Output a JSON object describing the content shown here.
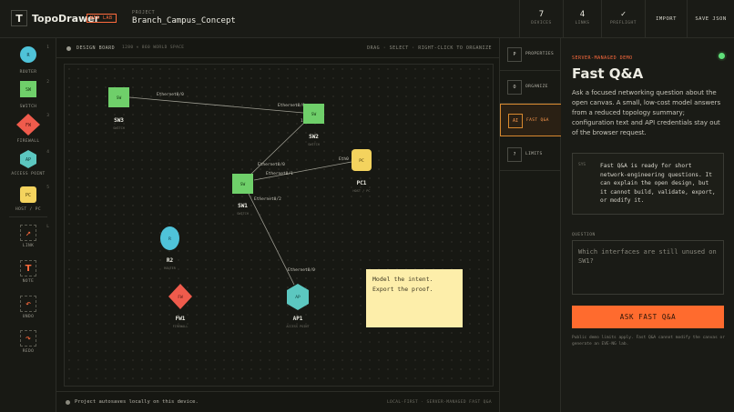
{
  "header": {
    "logo_letter": "T",
    "app_name": "TopoDrawer",
    "badge": "WEB LAB",
    "project_label": "PROJECT",
    "project_name": "Branch_Campus_Concept",
    "stats": [
      {
        "value": "7",
        "label": "DEVICES"
      },
      {
        "value": "4",
        "label": "LINKS"
      },
      {
        "value": "✓",
        "label": "PREFLIGHT"
      }
    ],
    "import_label": "IMPORT",
    "save_label": "SAVE JSON"
  },
  "toolbar": {
    "devices": [
      {
        "label": "ROUTER",
        "num": "1",
        "glyph": "R",
        "color": "#4fc3d9"
      },
      {
        "label": "SWITCH",
        "num": "2",
        "glyph": "SW",
        "color": "#6fcf6a"
      },
      {
        "label": "FIREWALL",
        "num": "3",
        "glyph": "FW",
        "color": "#ef5b4c"
      },
      {
        "label": "ACCESS POINT",
        "num": "4",
        "glyph": "AP",
        "color": "#5cc7c0"
      },
      {
        "label": "HOST / PC",
        "num": "5",
        "glyph": "PC",
        "color": "#f4d35e"
      }
    ],
    "tools": [
      {
        "label": "LINK",
        "num": "L",
        "glyph": "↗"
      },
      {
        "label": "NOTE",
        "num": "",
        "glyph": "T"
      },
      {
        "label": "UNDO",
        "num": "",
        "glyph": "↶"
      },
      {
        "label": "REDO",
        "num": "",
        "glyph": "↷"
      }
    ]
  },
  "canvas": {
    "title": "DESIGN BOARD",
    "subtitle": "1280 × 860 WORLD SPACE",
    "hint": "DRAG · SELECT · RIGHT-CLICK TO ORGANIZE",
    "nodes": [
      {
        "id": "SW3",
        "name": "SW3",
        "type": "SWITCH",
        "glyph": "SW",
        "shape": "square",
        "color": "#6fcf6a"
      },
      {
        "id": "SW2",
        "name": "SW2",
        "type": "SWITCH",
        "glyph": "SW",
        "shape": "square",
        "color": "#6fcf6a"
      },
      {
        "id": "SW1",
        "name": "SW1",
        "type": "SWITCH",
        "glyph": "SW",
        "shape": "square",
        "color": "#6fcf6a"
      },
      {
        "id": "PC1",
        "name": "PC1",
        "type": "HOST / PC",
        "glyph": "PC",
        "shape": "rounded",
        "color": "#f4d35e"
      },
      {
        "id": "R2",
        "name": "R2",
        "type": "ROUTER",
        "glyph": "R",
        "shape": "ellipse",
        "color": "#4fc3d9"
      },
      {
        "id": "FW1",
        "name": "FW1",
        "type": "FIREWALL",
        "glyph": "FW",
        "shape": "diamond",
        "color": "#ef5b4c"
      },
      {
        "id": "AP1",
        "name": "AP1",
        "type": "ACCESS POINT",
        "glyph": "AP",
        "shape": "hexagon",
        "color": "#5cc7c0"
      }
    ],
    "links": [
      {
        "from": "SW3",
        "to": "SW2",
        "from_port": "Ethernet0/0",
        "to_port": "Ethernet0/0"
      },
      {
        "from": "SW2",
        "to": "SW1",
        "from_port": "1",
        "to_port": "Ethernet0/0"
      },
      {
        "from": "SW1",
        "to": "PC1",
        "from_port": "Ethernet0/1",
        "to_port": "Eth0"
      },
      {
        "from": "SW1",
        "to": "AP1",
        "from_port": "Ethernet0/2",
        "to_port": "Ethernet0/0"
      }
    ],
    "note_lines": [
      "Model the intent.",
      "Export the proof."
    ]
  },
  "status": {
    "text": "Project autosaves locally on this device.",
    "right": "LOCAL-FIRST · SERVER-MANAGED FAST Q&A"
  },
  "tabs": [
    {
      "key": "P",
      "label": "PROPERTIES",
      "active": false
    },
    {
      "key": "O",
      "label": "ORGANIZE",
      "active": false
    },
    {
      "key": "AI",
      "label": "FAST Q&A",
      "active": true
    },
    {
      "key": "?",
      "label": "LIMITS",
      "active": false
    }
  ],
  "qa": {
    "tag": "SERVER-MANAGED DEMO",
    "title": "Fast Q&A",
    "description": "Ask a focused networking question about the open canvas. A small, low-cost model answers from a reduced topology summary; configuration text and API credentials stay out of the browser request.",
    "reply_sys": "SYS",
    "reply_text": "Fast Q&A is ready for short network-engineering questions. It can explain the open design, but it cannot build, validate, export, or modify it.",
    "question_label": "QUESTION",
    "question_placeholder": "Which interfaces are still unused on SW1?",
    "ask_button": "ASK FAST Q&A",
    "footnote": "Public demo limits apply. Fast Q&A cannot modify the canvas or generate an EVE-NG lab."
  }
}
